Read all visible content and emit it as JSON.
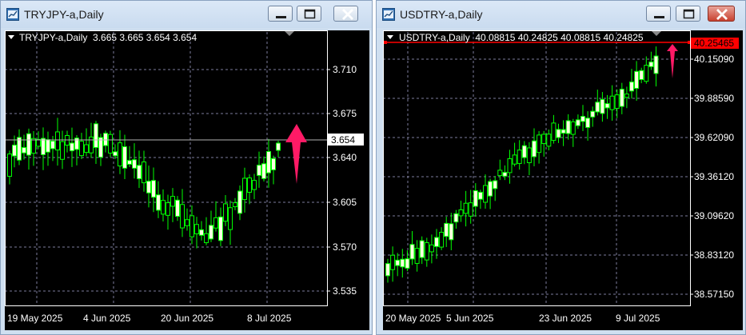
{
  "windows": [
    {
      "title": "TRYJPY-a,Daily",
      "header": "TRYJPY-a,Daily  3.665 3.665 3.654 3.654",
      "price_levels": [
        "3.710",
        "3.675",
        "3.640",
        "3.605",
        "3.570",
        "3.535"
      ],
      "current_price": "3.654",
      "date_labels": [
        "19 May 2025",
        "4 Jun 2025",
        "20 Jun 2025",
        "8 Jul 2025"
      ],
      "arrow_color": "#ff1a66"
    },
    {
      "title": "USDTRY-a,Daily",
      "header": "USDTRY-a,Daily  40.08815 40.24825 40.08815 40.24825",
      "price_levels": [
        "40.15090",
        "39.88590",
        "39.62090",
        "39.36120",
        "39.09620",
        "38.83120",
        "38.57150"
      ],
      "current_price": "40.25465",
      "date_labels": [
        "20 May 2025",
        "5 Jun 2025",
        "23 Jun 2025",
        "9 Jul 2025"
      ],
      "arrow_color": "#ff1a66"
    }
  ],
  "colors": {
    "chart_bg": "#000000",
    "candle": "#00ff00",
    "axis": "#ffffff",
    "grid": "#7d7d9b",
    "price_line_left": "#b4b4b4",
    "price_line_right": "#ff0000"
  },
  "icons": {
    "window_icon": "chart-window-icon",
    "minimize": "minimize-icon",
    "maximize": "maximize-icon",
    "close": "close-icon",
    "dropdown": "triangle-down-icon"
  }
}
